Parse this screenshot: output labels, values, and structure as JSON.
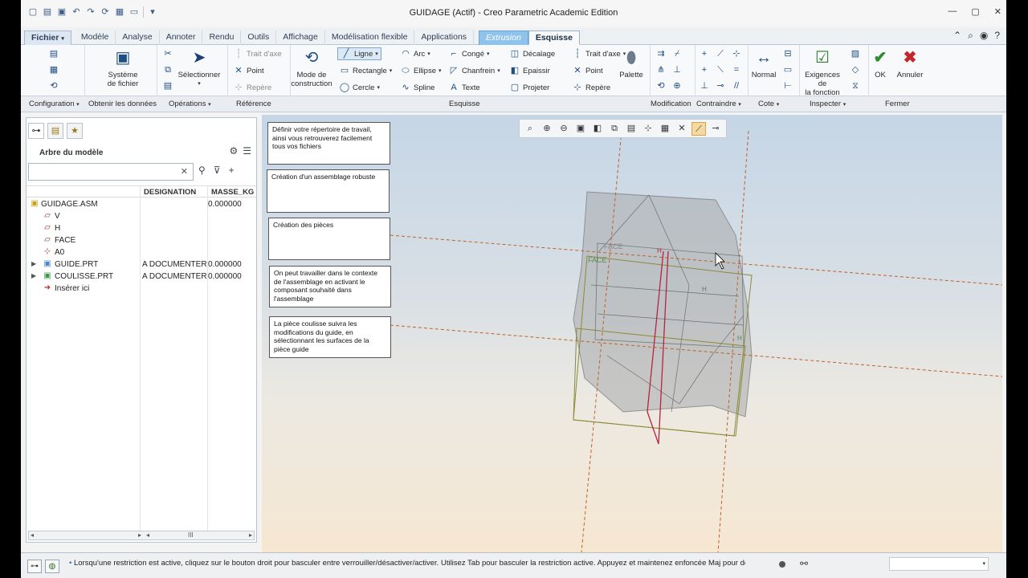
{
  "window": {
    "title": "GUIDAGE (Actif) - Creo Parametric Academic Edition"
  },
  "tabs": {
    "file": "Fichier",
    "items": [
      "Modèle",
      "Analyse",
      "Annoter",
      "Rendu",
      "Outils",
      "Affichage",
      "Modélisation flexible",
      "Applications"
    ],
    "extrusion": "Extrusion",
    "active": "Esquisse"
  },
  "ribbon": {
    "systeme": "Système\nde fichier",
    "selectionner": "Sélectionner",
    "trait_axe": "Trait d'axe",
    "point": "Point",
    "repere": "Repère",
    "mode_construction": "Mode de\nconstruction",
    "ligne": "Ligne",
    "rectangle": "Rectangle",
    "cercle": "Cercle",
    "arc": "Arc",
    "ellipse": "Ellipse",
    "spline": "Spline",
    "conge": "Congé",
    "chanfrein": "Chanfrein",
    "texte": "Texte",
    "decalage": "Décalage",
    "epaissir": "Epaissir",
    "projeter": "Projeter",
    "trait_axe2": "Trait d'axe",
    "point2": "Point",
    "repere2": "Repère",
    "palette": "Palette",
    "normal": "Normal",
    "exigences": "Exigences de\nla fonction",
    "ok": "OK",
    "annuler": "Annuler"
  },
  "groups": {
    "configuration": "Configuration",
    "obtenir": "Obtenir les données",
    "operations": "Opérations",
    "reference": "Référence",
    "esquisse": "Esquisse",
    "modification": "Modification",
    "contraindre": "Contraindre",
    "cote": "Cote",
    "inspecter": "Inspecter",
    "fermer": "Fermer"
  },
  "tree": {
    "title": "Arbre du modèle",
    "columns": {
      "designation": "DESIGNATION",
      "masse": "MASSE_KG"
    },
    "rows": [
      {
        "label": "GUIDAGE.ASM",
        "designation": "",
        "masse": "0.000000"
      },
      {
        "label": "V",
        "designation": "",
        "masse": ""
      },
      {
        "label": "H",
        "designation": "",
        "masse": ""
      },
      {
        "label": "FACE",
        "designation": "",
        "masse": ""
      },
      {
        "label": "A0",
        "designation": "",
        "masse": ""
      },
      {
        "label": "GUIDE.PRT",
        "designation": "A DOCUMENTER",
        "masse": "0.000000"
      },
      {
        "label": "COULISSE.PRT",
        "designation": "A DOCUMENTER",
        "masse": "0.000000"
      },
      {
        "label": "Insérer ici",
        "designation": "",
        "masse": ""
      }
    ],
    "scroll_label": "III"
  },
  "notes": [
    "Définir votre répertoire de travail, ainsi vous retrouverez facilement tous vos fichiers",
    "Création d'un assemblage robuste",
    "Création des pièces",
    "On peut travailler dans le contexte de l'assemblage en activant le composant souhaité dans l'assemblage",
    "La pièce coulisse suivra les modifications du guide, en sélectionnant les surfaces de la pièce guide"
  ],
  "viewport_labels": {
    "face1": "FACE",
    "face2": "FACE",
    "h1": "H",
    "h2": "H",
    "h3": "H"
  },
  "status": {
    "message": "Lorsqu'une restriction est active, cliquez sur le bouton droit pour basculer entre verrouiller/désactiver/activer. Utilisez Tab pour basculer la restriction active. Appuyez et maintenez enfoncée Maj pour désacti"
  },
  "colors": {
    "accent": "#8fc3ec",
    "ok": "#2e8b2e",
    "cancel": "#c0282d"
  }
}
